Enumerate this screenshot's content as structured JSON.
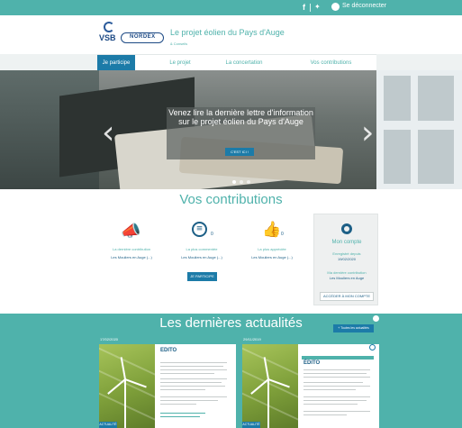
{
  "topbar": {
    "facebook_icon": "f",
    "twitter_icon": "twitter-icon",
    "user_icon": "user-icon",
    "logout_label": "Se déconnecter"
  },
  "header": {
    "logo_vsb": "VSB",
    "logo_nordex": "NORDEX",
    "title": "Le projet éolien du Pays d'Auge",
    "subtitle": "& Conseils"
  },
  "nav": {
    "items": [
      {
        "label": "Je participe",
        "active": true
      },
      {
        "label": "Le projet"
      },
      {
        "label": "La concertation"
      },
      {
        "label": "Vos contributions"
      }
    ]
  },
  "hero": {
    "caption": "Venez lire la dernière lettre d'information sur le projet éolien du Pays d'Auge",
    "cta_label": "C'EST ICI !",
    "prev_icon": "chevron-left-icon",
    "next_icon": "chevron-right-icon"
  },
  "contributions": {
    "title": "Vos contributions",
    "stats": [
      {
        "icon": "megaphone-icon",
        "count": "",
        "label": "La dernière contribution",
        "value": "Les Mouliers en Auge (...)"
      },
      {
        "icon": "comment-icon",
        "count": "0",
        "label": "La plus commentée",
        "value": "Les Mouliers en Auge (...)"
      },
      {
        "icon": "thumbs-up-icon",
        "count": "0",
        "label": "La plus appréciée",
        "value": "Les Mouliers en Auge (...)"
      }
    ],
    "participate_label": "JE PARTICIPE",
    "account": {
      "title": "Mon compte",
      "line1": "Enregistré depuis",
      "line2": "19/02/2020",
      "line3": "Ma dernière contribution",
      "line4": "Les Mouliers en Auge",
      "button": "ACCÉDER À MON COMPTE"
    }
  },
  "news": {
    "title": "Les dernières actualités",
    "all_button": "+ Toutes les actualités",
    "cards": [
      {
        "date": "17/02/2020",
        "doc_title": "EDITO",
        "badge": "ACTUALITÉ"
      },
      {
        "date": "29/11/2019",
        "doc_title": "ÉDITO",
        "badge": "ACTUALITÉ"
      }
    ]
  },
  "colors": {
    "teal": "#4fb2ab",
    "blue": "#1c7ba8",
    "navy": "#1c5f86"
  }
}
